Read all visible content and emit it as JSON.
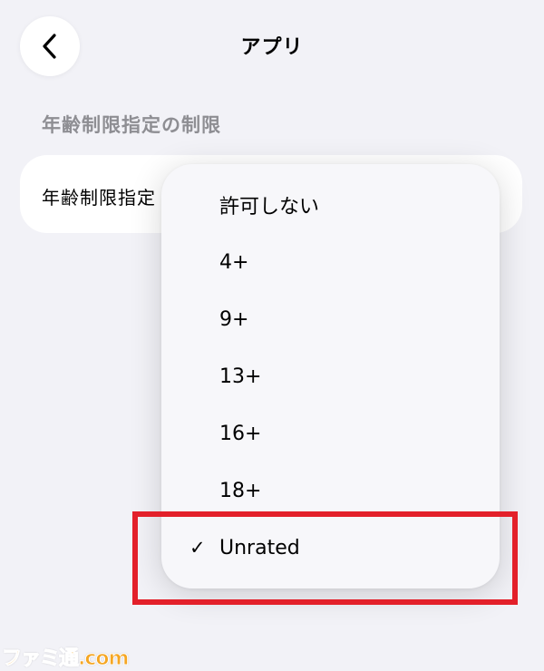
{
  "nav": {
    "title": "アプリ"
  },
  "section": {
    "header": "年齢制限指定の制限"
  },
  "setting_row": {
    "label": "年齢制限指定"
  },
  "menu": {
    "items": [
      {
        "label": "許可しない",
        "checked": false
      },
      {
        "label": "4+",
        "checked": false
      },
      {
        "label": "9+",
        "checked": false
      },
      {
        "label": "13+",
        "checked": false
      },
      {
        "label": "16+",
        "checked": false
      },
      {
        "label": "18+",
        "checked": false
      },
      {
        "label": "Unrated",
        "checked": true
      }
    ],
    "check_glyph": "✓"
  },
  "annotation": {
    "highlight_color": "#e3202a"
  },
  "watermark": {
    "text": "ファミ通.com"
  },
  "icons": {
    "back": "chevron-left-icon",
    "check": "checkmark-icon"
  }
}
